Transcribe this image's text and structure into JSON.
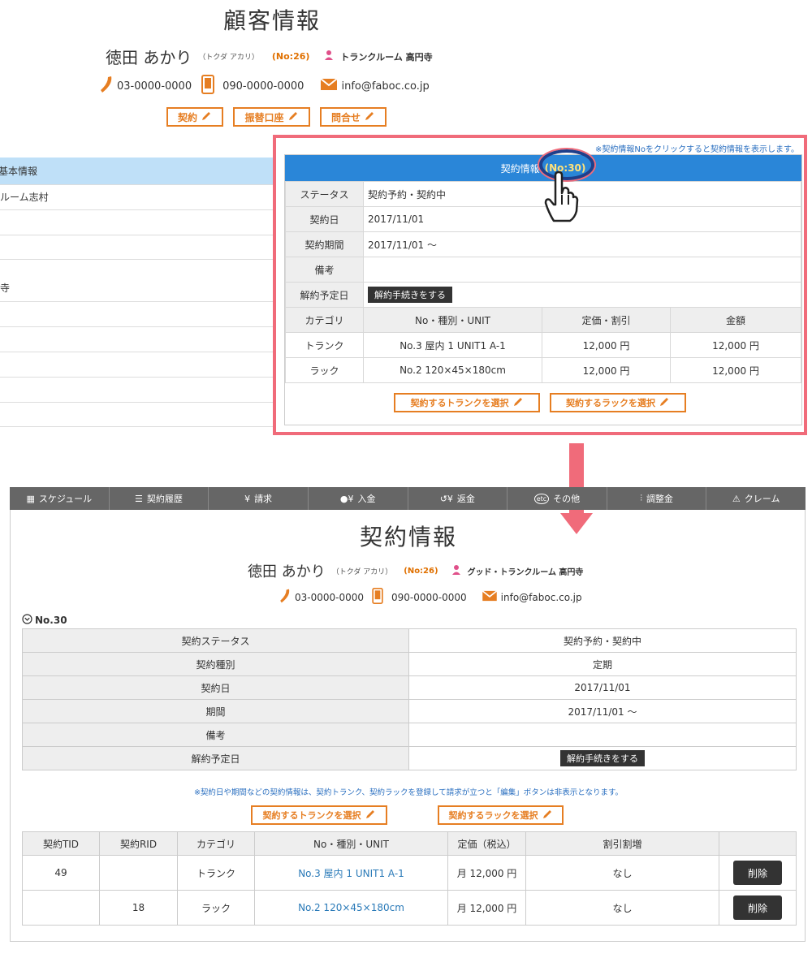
{
  "top": {
    "title": "顧客情報",
    "customer_name": "徳田 あかり",
    "kana": "（トクダ アカリ）",
    "customer_no": "(No:26)",
    "store": "トランクルーム 高円寺",
    "phone": "03-0000-0000",
    "mobile": "090-0000-0000",
    "email": "info@faboc.co.jp",
    "buttons": [
      "契約",
      "振替口座",
      "問合せ"
    ]
  },
  "left": {
    "header": "基本情報",
    "row1": "ルーム志村",
    "row2": "寺"
  },
  "panel": {
    "note": "※契約情報Noをクリックすると契約情報を表示します。",
    "header_label": "契約情報",
    "header_no": "(No:30)",
    "rows": [
      {
        "label": "ステータス",
        "value": "契約予約・契約中"
      },
      {
        "label": "契約日",
        "value": "2017/11/01"
      },
      {
        "label": "契約期間",
        "value": "2017/11/01 ～"
      },
      {
        "label": "備考",
        "value": ""
      },
      {
        "label": "解約予定日",
        "button": "解約手続きをする"
      }
    ],
    "columns": [
      "カテゴリ",
      "No・種別・UNIT",
      "定価・割引",
      "金額"
    ],
    "items": [
      {
        "category": "トランク",
        "unit": "No.3 屋内 1 UNIT1 A-1",
        "price": "12,000 円",
        "amount": "12,000 円"
      },
      {
        "category": "ラック",
        "unit": "No.2 120×45×180cm",
        "price": "12,000 円",
        "amount": "12,000 円"
      }
    ],
    "select_trunk": "契約するトランクを選択",
    "select_rack": "契約するラックを選択"
  },
  "toolbar": [
    "スケジュール",
    "契約履歴",
    "請求",
    "入金",
    "返金",
    "その他",
    "調整金",
    "クレーム"
  ],
  "bottom": {
    "title": "契約情報",
    "customer_name": "徳田 あかり",
    "kana": "（トクダ アカリ）",
    "customer_no": "(No:26)",
    "store": "グッド・トランクルーム 高円寺",
    "phone": "03-0000-0000",
    "mobile": "090-0000-0000",
    "email": "info@faboc.co.jp",
    "section": "No.30",
    "rows": [
      {
        "label": "契約ステータス",
        "value": "契約予約・契約中"
      },
      {
        "label": "契約種別",
        "value": "定期"
      },
      {
        "label": "契約日",
        "value": "2017/11/01"
      },
      {
        "label": "期間",
        "value": "2017/11/01 ～"
      },
      {
        "label": "備考",
        "value": ""
      },
      {
        "label": "解約予定日",
        "button": "解約手続きをする"
      }
    ],
    "note": "※契約日や期間などの契約情報は、契約トランク、契約ラックを登録して請求が立つと「編集」ボタンは非表示となります。",
    "select_trunk": "契約するトランクを選択",
    "select_rack": "契約するラックを選択",
    "columns": [
      "契約TID",
      "契約RID",
      "カテゴリ",
      "No・種別・UNIT",
      "定価（税込）",
      "割引割増",
      ""
    ],
    "items": [
      {
        "tid": "49",
        "rid": "",
        "category": "トランク",
        "unit": "No.3 屋内 1 UNIT1 A-1",
        "price": "月 12,000 円",
        "discount": "なし",
        "delete": "削除"
      },
      {
        "tid": "",
        "rid": "18",
        "category": "ラック",
        "unit": "No.2 120×45×180cm",
        "price": "月 12,000 円",
        "discount": "なし",
        "delete": "削除"
      }
    ]
  }
}
